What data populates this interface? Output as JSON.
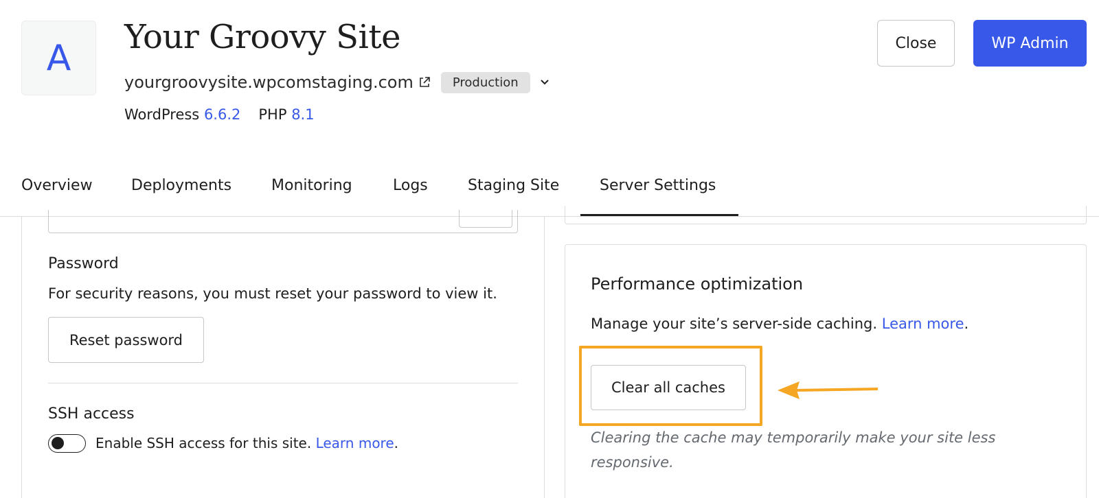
{
  "header": {
    "site_icon_letter": "A",
    "site_title": "Your Groovy Site",
    "domain": "yourgroovysite.wpcomstaging.com",
    "environment_badge": "Production",
    "wordpress_label": "WordPress",
    "wordpress_version": "6.6.2",
    "php_label": "PHP",
    "php_version": "8.1",
    "close_label": "Close",
    "wp_admin_label": "WP Admin"
  },
  "tabs": [
    {
      "label": "Overview"
    },
    {
      "label": "Deployments"
    },
    {
      "label": "Monitoring"
    },
    {
      "label": "Logs"
    },
    {
      "label": "Staging Site"
    },
    {
      "label": "Server Settings",
      "active": true
    }
  ],
  "left_panel": {
    "password_heading": "Password",
    "password_desc": "For security reasons, you must reset your password to view it.",
    "reset_button": "Reset password",
    "ssh_heading": "SSH access",
    "ssh_toggle_label": "Enable SSH access for this site.",
    "ssh_learn_more": "Learn more",
    "ssh_enabled": false
  },
  "right_panel": {
    "perf_heading": "Performance optimization",
    "perf_desc": "Manage your site’s server-side caching.",
    "perf_learn_more": "Learn more",
    "clear_button": "Clear all caches",
    "cache_note": "Clearing the cache may temporarily make your site less responsive."
  },
  "colors": {
    "accent": "#3858e9",
    "highlight": "#f5a623"
  },
  "icons": [
    "external-link-icon",
    "chevron-down-icon",
    "arrow-left-icon"
  ]
}
